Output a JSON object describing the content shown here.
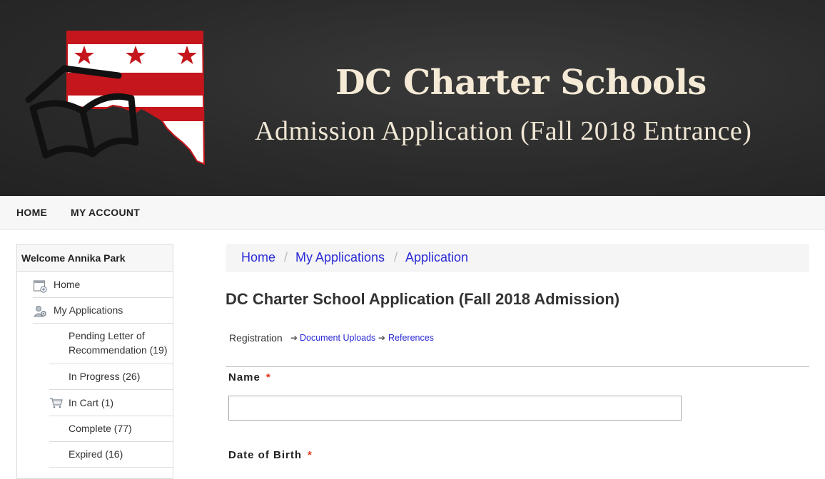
{
  "banner": {
    "title": "DC Charter Schools",
    "subtitle": "Admission Application (Fall 2018 Entrance)"
  },
  "topnav": {
    "items": [
      {
        "label": "HOME"
      },
      {
        "label": "MY ACCOUNT"
      }
    ]
  },
  "sidebar": {
    "welcome": "Welcome Annika Park",
    "items": [
      {
        "label": "Home",
        "icon": "calendar-add-icon"
      },
      {
        "label": "My Applications",
        "icon": "user-gear-icon"
      }
    ],
    "subitems": [
      {
        "label_line1": "Pending Letter of",
        "label_line2": "Recommendation (19)"
      },
      {
        "label": "In Progress (26)"
      },
      {
        "label": "In Cart (1)",
        "icon": "cart-icon"
      },
      {
        "label": "Complete (77)"
      },
      {
        "label": "Expired (16)"
      }
    ]
  },
  "breadcrumb": {
    "items": [
      "Home",
      "My Applications",
      "Application"
    ],
    "separator": "/"
  },
  "page_title": "DC Charter School Application (Fall 2018 Admission)",
  "steps": {
    "current": "Registration",
    "links": [
      "Document Uploads",
      "References"
    ],
    "arrow": "➔"
  },
  "form": {
    "name_label": "Name",
    "name_value": "",
    "dob_label": "Date of Birth",
    "required_mark": "*"
  },
  "colors": {
    "link": "#2a2ad6",
    "required": "#e0351b",
    "flag_red": "#c4161c"
  }
}
